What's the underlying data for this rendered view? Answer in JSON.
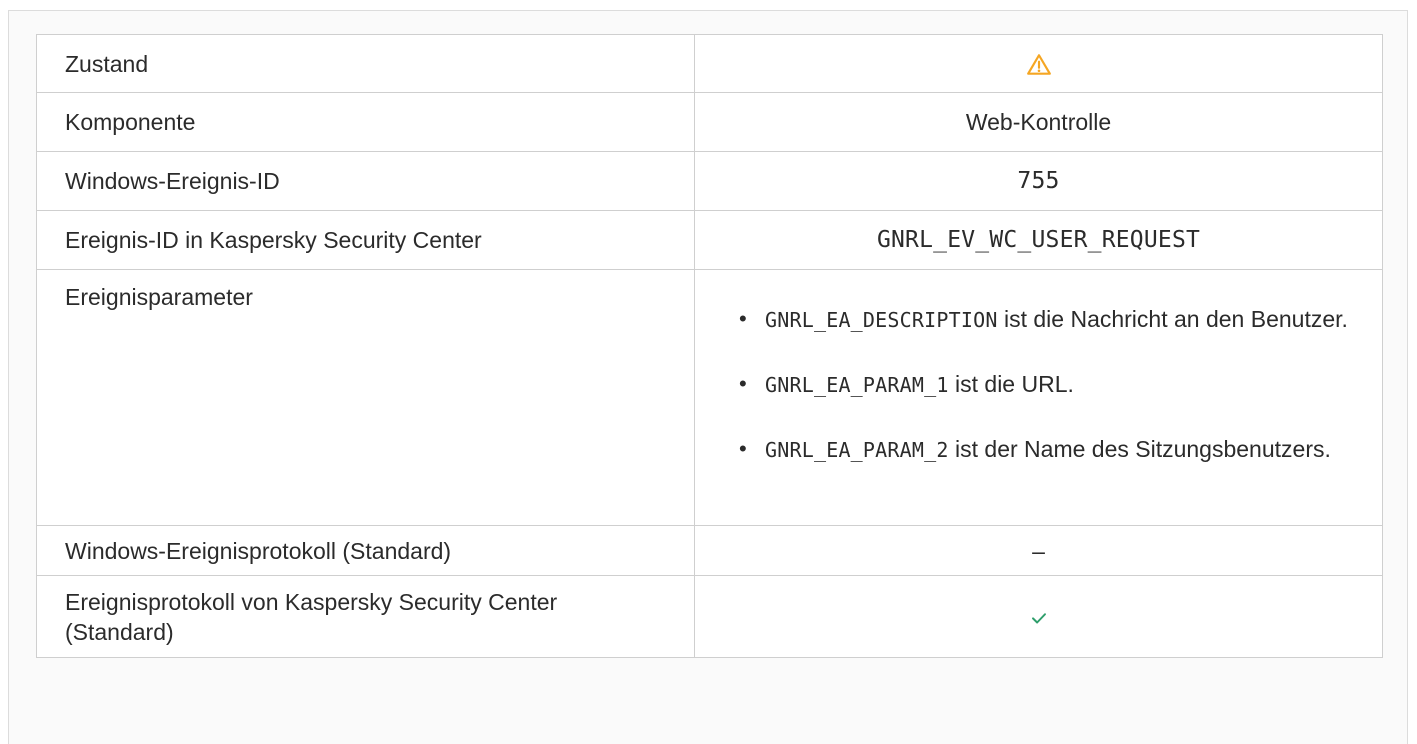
{
  "rows": [
    {
      "label": "Zustand",
      "value_icon": "warning-triangle-icon"
    },
    {
      "label": "Komponente",
      "value": "Web-Kontrolle"
    },
    {
      "label": "Windows-Ereignis-ID",
      "value": "755"
    },
    {
      "label": "Ereignis-ID in Kaspersky Security Center",
      "value": "GNRL_EV_WC_USER_REQUEST"
    },
    {
      "label": "Ereignisparameter",
      "params": [
        {
          "code": "GNRL_EA_DESCRIPTION",
          "text": " ist die Nachricht an den Benutzer."
        },
        {
          "code": "GNRL_EA_PARAM_1",
          "text": " ist die URL."
        },
        {
          "code": "GNRL_EA_PARAM_2",
          "text": " ist der Name des Sitzungsbenutzers."
        }
      ]
    },
    {
      "label": "Windows-Ereignisprotokoll (Standard)",
      "value": "–"
    },
    {
      "label": "Ereignisprotokoll von Kaspersky Security Center (Standard)",
      "value_icon": "checkmark-icon"
    }
  ],
  "colors": {
    "warning": "#f5a623",
    "check": "#2e9e6b",
    "border": "#cfcfcf"
  }
}
